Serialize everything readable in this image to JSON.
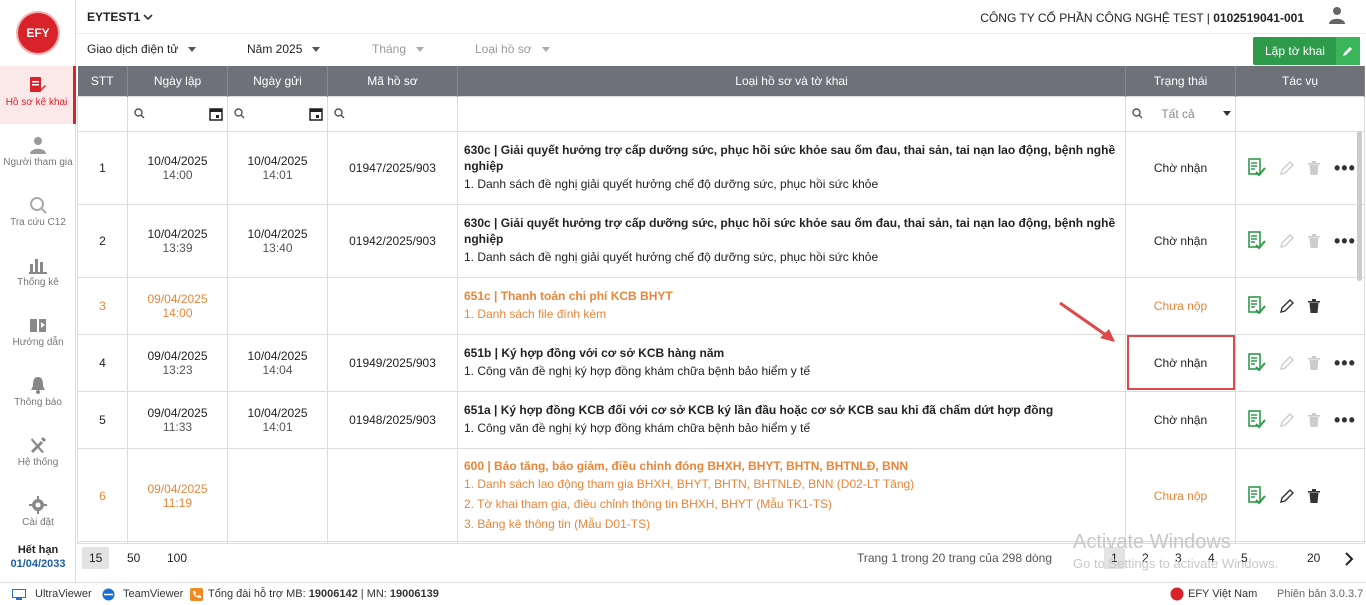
{
  "app": {
    "logo_text": "EFY",
    "title": "EYTEST1",
    "company": "CÔNG TY CỔ PHẦN CÔNG NGHỆ TEST | ",
    "tax_code": "0102519041-001"
  },
  "sidebar": {
    "items": [
      {
        "label": "Hồ sơ kê khai",
        "icon": "document-edit-icon"
      },
      {
        "label": "Người tham gia",
        "icon": "person-icon"
      },
      {
        "label": "Tra cứu C12",
        "icon": "search-doc-icon"
      },
      {
        "label": "Thống kê",
        "icon": "bar-chart-icon"
      },
      {
        "label": "Hướng dẫn",
        "icon": "guide-book-icon"
      },
      {
        "label": "Thông báo",
        "icon": "bell-icon"
      },
      {
        "label": "Hệ thống",
        "icon": "tools-icon"
      },
      {
        "label": "Cài đặt",
        "icon": "gear-icon"
      }
    ],
    "expiry_label": "Hết hạn",
    "expiry_date": "01/04/2033"
  },
  "filters": {
    "transaction": "Giao dịch điện tử",
    "year": "Năm 2025",
    "month": "Tháng",
    "type": "Loại hồ sơ"
  },
  "create_button": "Lập tờ khai",
  "table": {
    "headers": [
      "STT",
      "Ngày lập",
      "Ngày gửi",
      "Mã hồ sơ",
      "Loại hồ sơ và tờ khai",
      "Trạng thái",
      "Tác vụ"
    ],
    "status_filter": "Tất cả",
    "rows": [
      {
        "stt": "1",
        "created_date": "10/04/2025",
        "created_time": "14:00",
        "sent_date": "10/04/2025",
        "sent_time": "14:01",
        "code": "01947/2025/903",
        "title": "630c | Giải quyết hưởng trợ cấp dưỡng sức, phục hồi sức khỏe sau ốm đau, thai sản, tai nạn lao động, bệnh nghề nghiệp",
        "subs": [
          "1. Danh sách đề nghị giải quyết hưởng chế độ dưỡng sức, phục hồi sức khỏe"
        ],
        "status": "Chờ nhận"
      },
      {
        "stt": "2",
        "created_date": "10/04/2025",
        "created_time": "13:39",
        "sent_date": "10/04/2025",
        "sent_time": "13:40",
        "code": "01942/2025/903",
        "title": "630c | Giải quyết hưởng trợ cấp dưỡng sức, phục hồi sức khỏe sau ốm đau, thai sản, tai nạn lao động, bệnh nghề nghiệp",
        "subs": [
          "1. Danh sách đề nghị giải quyết hưởng chế độ dưỡng sức, phục hồi sức khỏe"
        ],
        "status": "Chờ nhận"
      },
      {
        "stt": "3",
        "created_date": "09/04/2025",
        "created_time": "14:00",
        "sent_date": "",
        "sent_time": "",
        "code": "",
        "title": "651c | Thanh toán chi phí KCB BHYT",
        "subs": [
          "1. Danh sách file đính kèm"
        ],
        "status": "Chưa nộp"
      },
      {
        "stt": "4",
        "created_date": "09/04/2025",
        "created_time": "13:23",
        "sent_date": "10/04/2025",
        "sent_time": "14:04",
        "code": "01949/2025/903",
        "title": "651b | Ký hợp đồng với cơ sở KCB hàng năm",
        "subs": [
          "1. Công văn đề nghị ký hợp đồng khám chữa bệnh bảo hiểm y tế"
        ],
        "status": "Chờ nhận"
      },
      {
        "stt": "5",
        "created_date": "09/04/2025",
        "created_time": "11:33",
        "sent_date": "10/04/2025",
        "sent_time": "14:01",
        "code": "01948/2025/903",
        "title": "651a | Ký hợp đồng KCB đối với cơ sở KCB ký lần đầu hoặc cơ sở KCB sau khi đã chấm dứt hợp đồng",
        "subs": [
          "1. Công văn đề nghị ký hợp đồng khám chữa bệnh bảo hiểm y tế"
        ],
        "status": "Chờ nhận"
      },
      {
        "stt": "6",
        "created_date": "09/04/2025",
        "created_time": "11:19",
        "sent_date": "",
        "sent_time": "",
        "code": "",
        "title": "600 | Báo tăng, báo giảm, điều chỉnh đóng BHXH, BHYT, BHTN, BHTNLĐ, BNN",
        "subs": [
          "1. Danh sách lao động tham gia BHXH, BHYT, BHTN, BHTNLĐ, BNN (D02-LT Tăng)",
          "2. Tờ khai tham gia, điều chỉnh thông tin BHXH, BHYT (Mẫu TK1-TS)",
          "3. Bảng kê thông tin (Mẫu D01-TS)"
        ],
        "status": "Chưa nộp"
      }
    ]
  },
  "pager": {
    "sizes": [
      "15",
      "50",
      "100"
    ],
    "info": "Trang 1 trong 20 trang của 298 dòng",
    "pages": [
      "1",
      "2",
      "3",
      "4",
      "5",
      "20"
    ]
  },
  "footer": {
    "ultraviewer": "UltraViewer",
    "teamviewer": "TeamViewer",
    "hotline_prefix": "Tổng đài hỗ trợ MB: ",
    "mb": "19006142",
    "mn_prefix": " | MN: ",
    "mn": "19006139",
    "brand": "EFY Việt Nam",
    "version": "Phiên bản 3.0.3.7"
  },
  "watermark": {
    "line1": "Activate Windows",
    "line2": "Go to Settings to activate Windows."
  },
  "colors": {
    "accent": "#d8232a",
    "green": "#2e9b4a",
    "orange": "#e8863a",
    "header": "#6e7278"
  }
}
